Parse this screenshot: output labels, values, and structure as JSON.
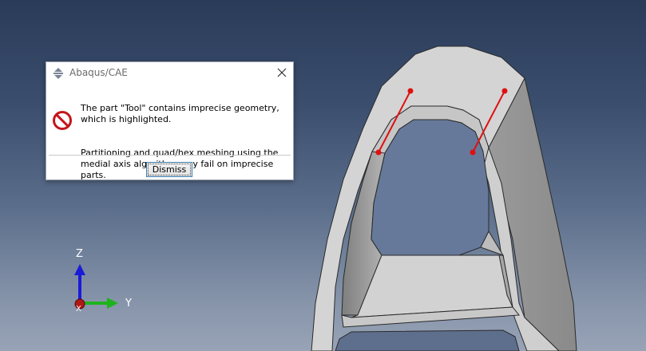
{
  "dialog": {
    "title": "Abaqus/CAE",
    "message_line1": "The part \"Tool\"  contains imprecise geometry,\nwhich is highlighted.",
    "message_line2": "Partitioning and quad/hex meshing using the\nmedial axis algorithm may fail on imprecise parts.",
    "dismiss_label": "Dismiss",
    "icons": {
      "app": "abaqus-app-icon",
      "close": "close-icon",
      "message": "stop-icon"
    }
  },
  "triad": {
    "z_label": "Z",
    "y_label": "Y",
    "x_label": "X",
    "colors": {
      "z": "#1a1ad8",
      "y": "#1db31d",
      "x": "#b01818"
    }
  },
  "viewport": {
    "background_top": "#2a3b58",
    "background_bottom": "#98a3b6",
    "highlight_color": "#e01010"
  }
}
